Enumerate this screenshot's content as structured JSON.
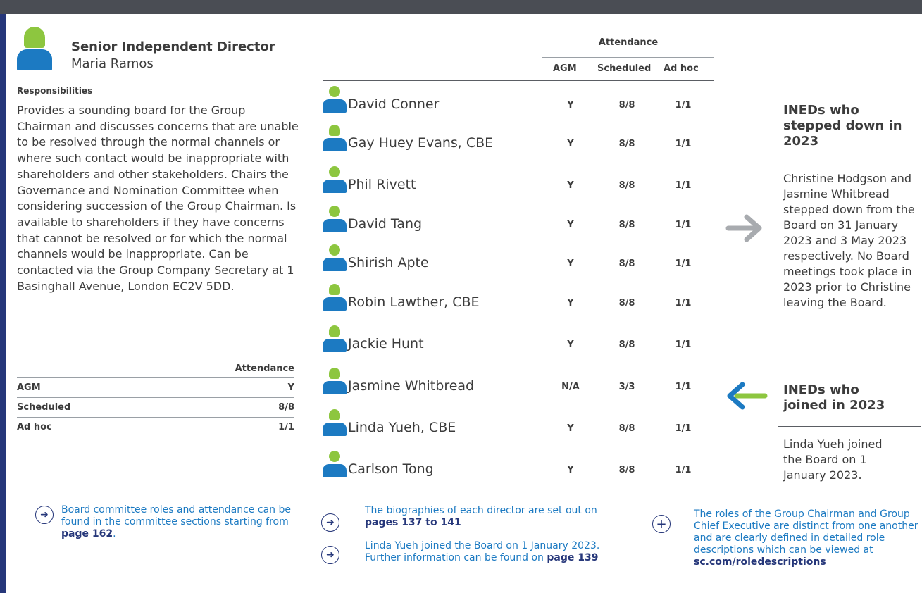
{
  "sid": {
    "title": "Senior Independent Director",
    "name": "Maria Ramos",
    "responsibilities_heading": "Responsibilities",
    "responsibilities_text": "Provides a sounding board for the Group Chairman and discusses concerns that are unable to be resolved through the normal channels or where such contact would be inappropriate with shareholders and other stakeholders. Chairs the Governance and Nomination Committee when considering succession of the Group Chairman. Is available to shareholders if they have concerns that cannot be resolved or for which the normal channels would be inappropriate. Can be contacted via the Group Company Secretary at 1 Basinghall Avenue, London EC2V 5DD.",
    "attendance_heading": "Attendance",
    "attendance": [
      {
        "label": "AGM",
        "value": "Y"
      },
      {
        "label": "Scheduled",
        "value": "8/8"
      },
      {
        "label": "Ad hoc",
        "value": "1/1"
      }
    ]
  },
  "notes": {
    "left": {
      "text": "Board committee roles and attendance can be found in the committee sections starting from ",
      "link": "page 162",
      "suffix": "."
    },
    "mid1": {
      "text": "The biographies of each director are set out on ",
      "link": "pages 137 to 141"
    },
    "mid2": {
      "text": "Linda Yueh joined the Board on 1 January 2023. Further information can be found on ",
      "link": "page 139"
    },
    "right": {
      "text": "The roles of the Group Chairman and Group Chief Executive are distinct from one another and are clearly defined in detailed role descriptions which can be viewed at ",
      "link": "sc.com/roledescriptions"
    }
  },
  "table": {
    "attendance_heading": "Attendance",
    "columns": [
      "AGM",
      "Scheduled",
      "Ad hoc"
    ],
    "rows": [
      {
        "name": "David Conner",
        "icon": "male-person-icon",
        "agm": "Y",
        "scheduled": "8/8",
        "adhoc": "1/1"
      },
      {
        "name": "Gay Huey Evans, CBE",
        "icon": "female-person-icon",
        "agm": "Y",
        "scheduled": "8/8",
        "adhoc": "1/1"
      },
      {
        "name": "Phil Rivett",
        "icon": "male-person-icon",
        "agm": "Y",
        "scheduled": "8/8",
        "adhoc": "1/1"
      },
      {
        "name": "David Tang",
        "icon": "male-person-icon",
        "agm": "Y",
        "scheduled": "8/8",
        "adhoc": "1/1"
      },
      {
        "name": "Shirish Apte",
        "icon": "male-person-icon",
        "agm": "Y",
        "scheduled": "8/8",
        "adhoc": "1/1"
      },
      {
        "name": "Robin Lawther, CBE",
        "icon": "female-person-icon",
        "agm": "Y",
        "scheduled": "8/8",
        "adhoc": "1/1"
      },
      {
        "name": "Jackie Hunt",
        "icon": "female-person-icon",
        "agm": "Y",
        "scheduled": "8/8",
        "adhoc": "1/1"
      },
      {
        "name": "Jasmine Whitbread",
        "icon": "female-person-icon",
        "agm": "N/A",
        "scheduled": "3/3",
        "adhoc": "1/1"
      },
      {
        "name": "Linda Yueh, CBE",
        "icon": "female-person-icon",
        "agm": "Y",
        "scheduled": "8/8",
        "adhoc": "1/1"
      },
      {
        "name": "Carlson Tong",
        "icon": "male-person-icon",
        "agm": "Y",
        "scheduled": "8/8",
        "adhoc": "1/1"
      }
    ]
  },
  "right": {
    "stepped_down_title": "INEDs who stepped down in 2023",
    "stepped_down_text": "Christine Hodgson and Jasmine Whitbread stepped down from the Board on 31 January 2023 and 3 May 2023 respectively. No Board meetings took place in 2023 prior to Christine leaving the Board.",
    "joined_title": "INEDs who joined in 2023",
    "joined_text": "Linda Yueh joined the Board on 1 January 2023."
  },
  "colors": {
    "blue": "#1c7ac2",
    "green": "#8dc63f",
    "navy": "#26377a",
    "grey_arrow": "#a8abaf"
  }
}
